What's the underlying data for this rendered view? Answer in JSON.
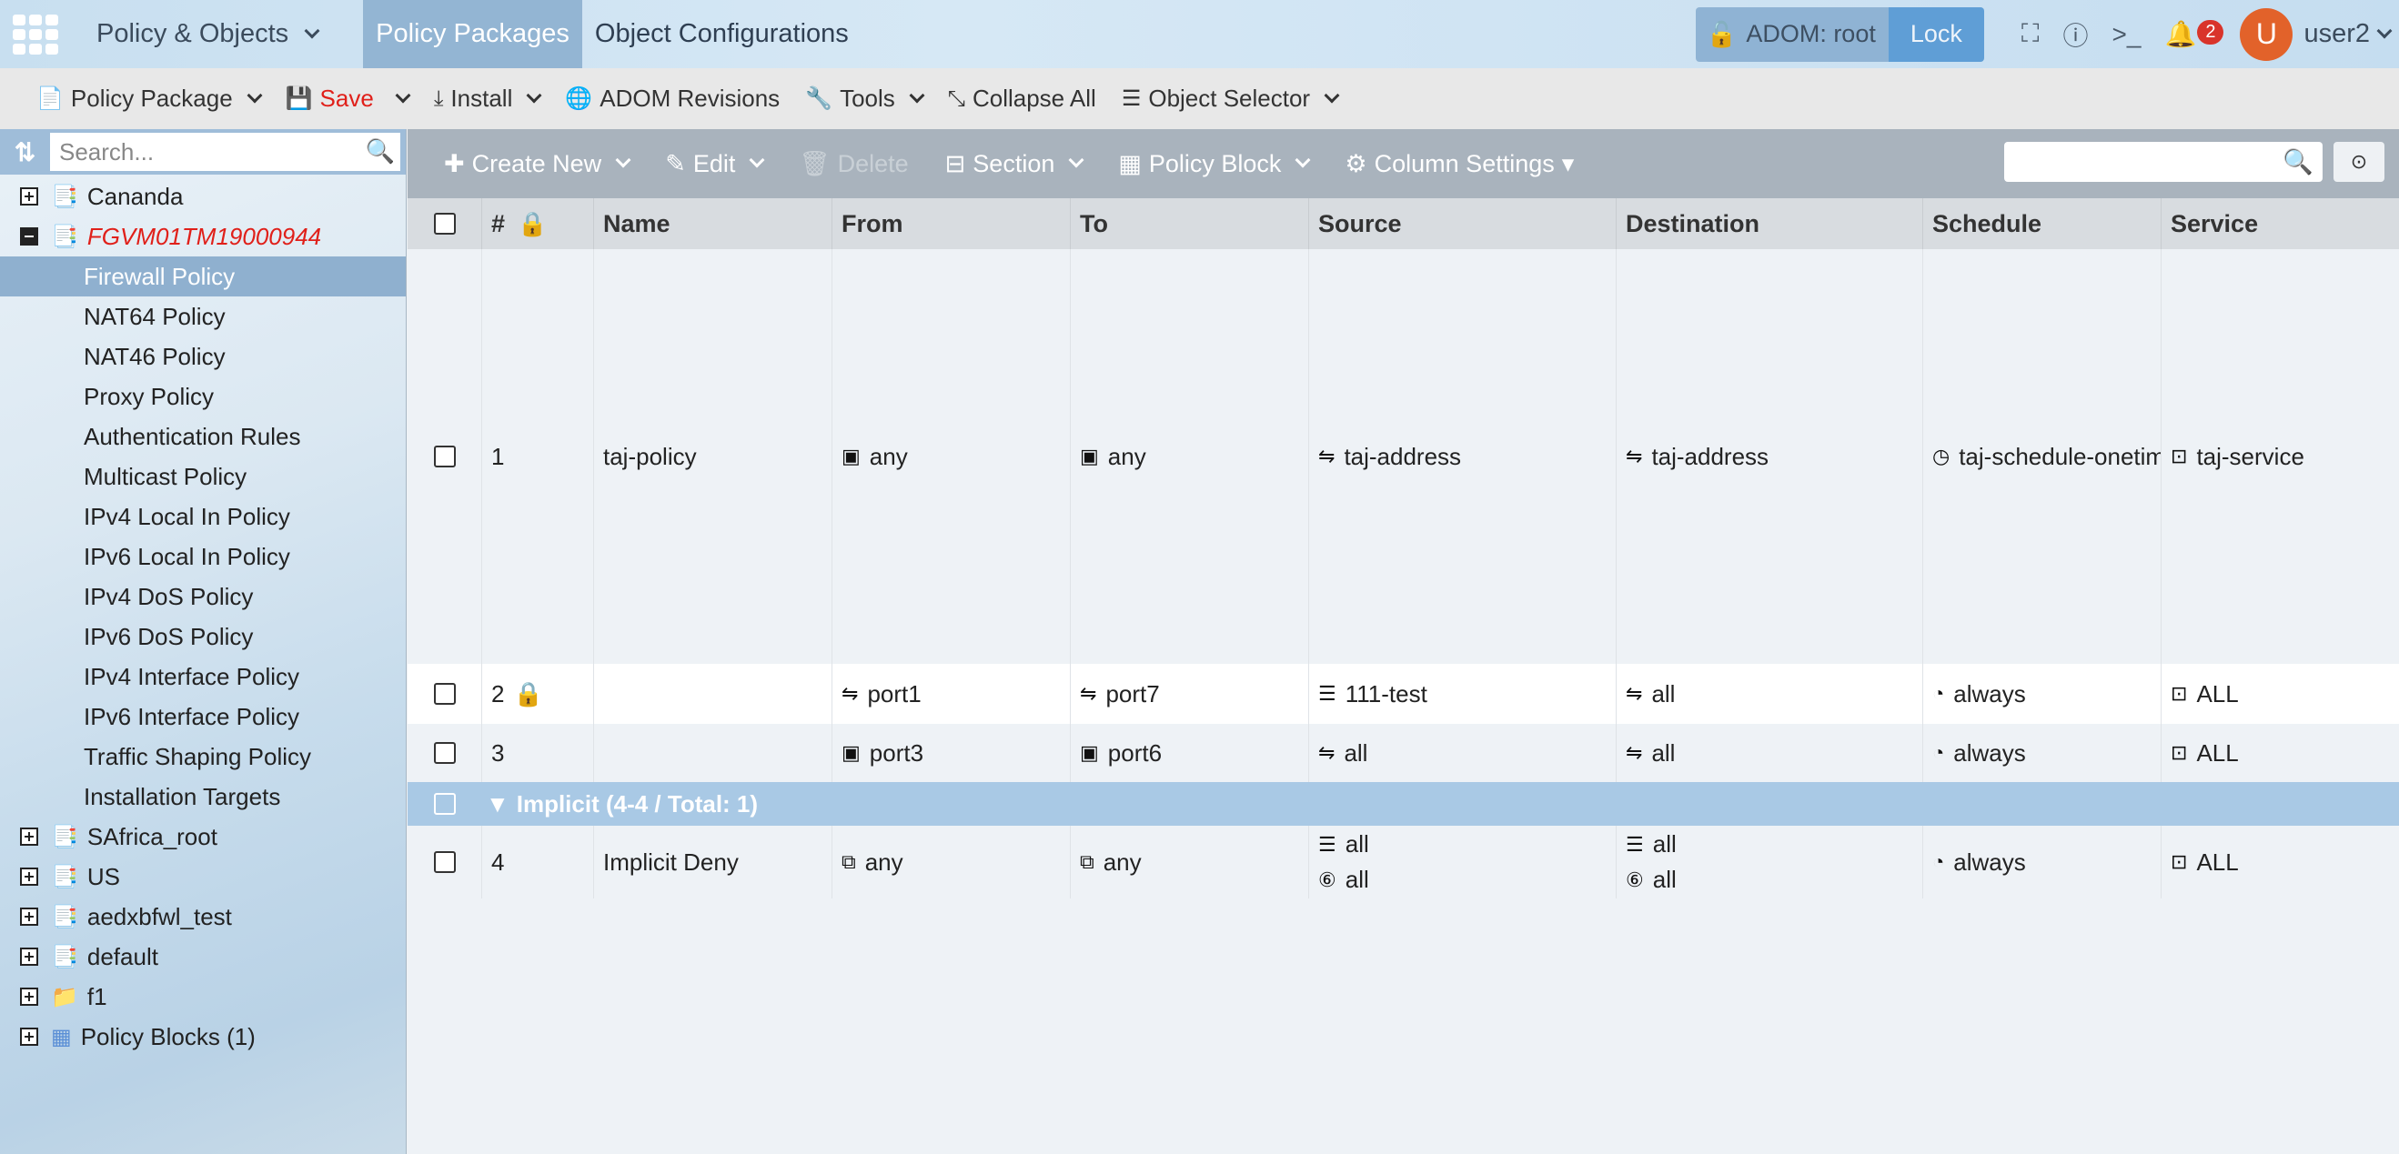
{
  "topbar": {
    "menu_label": "Policy & Objects",
    "tabs": [
      {
        "label": "Policy Packages",
        "active": true
      },
      {
        "label": "Object Configurations",
        "active": false
      }
    ],
    "adom_label": "ADOM: root",
    "lock_label": "Lock",
    "notification_count": "2",
    "avatar_letter": "U",
    "username": "user2"
  },
  "toolbar": {
    "policy_package": "Policy Package",
    "save": "Save",
    "install": "Install",
    "adom_revisions": "ADOM Revisions",
    "tools": "Tools",
    "collapse_all": "Collapse All",
    "object_selector": "Object Selector"
  },
  "sidebar": {
    "search_placeholder": "Search...",
    "tree": [
      {
        "label": "Cananda",
        "expand": "plus"
      },
      {
        "label": "FGVM01TM19000944",
        "expand": "minus"
      },
      {
        "label": "Firewall Policy",
        "selected": true
      },
      {
        "label": "NAT64 Policy"
      },
      {
        "label": "NAT46 Policy"
      },
      {
        "label": "Proxy Policy"
      },
      {
        "label": "Authentication Rules"
      },
      {
        "label": "Multicast Policy"
      },
      {
        "label": "IPv4 Local In Policy"
      },
      {
        "label": "IPv6 Local In Policy"
      },
      {
        "label": "IPv4 DoS Policy"
      },
      {
        "label": "IPv6 DoS Policy"
      },
      {
        "label": "IPv4 Interface Policy"
      },
      {
        "label": "IPv6 Interface Policy"
      },
      {
        "label": "Traffic Shaping Policy"
      },
      {
        "label": "Installation Targets"
      },
      {
        "label": "SAfrica_root",
        "expand": "plus"
      },
      {
        "label": "US",
        "expand": "plus"
      },
      {
        "label": "aedxbfwl_test",
        "expand": "plus"
      },
      {
        "label": "default",
        "expand": "plus"
      },
      {
        "label": "f1",
        "expand": "plus"
      },
      {
        "label": "Policy Blocks (1)",
        "expand": "plus"
      }
    ]
  },
  "policy_toolbar": {
    "create_new": "Create New",
    "edit": "Edit",
    "delete": "Delete",
    "section": "Section",
    "policy_block": "Policy Block",
    "column_settings": "Column Settings"
  },
  "table": {
    "headers": {
      "num": "#",
      "name": "Name",
      "from": "From",
      "to": "To",
      "source": "Source",
      "destination": "Destination",
      "schedule": "Schedule",
      "service": "Service"
    },
    "rows": [
      {
        "num": "1",
        "name": "taj-policy",
        "from": "any",
        "to": "any",
        "source": "taj-address",
        "destination": "taj-address",
        "schedule": "taj-schedule-onetime",
        "service": "taj-service"
      },
      {
        "num": "2",
        "name": "",
        "from": "port1",
        "to": "port7",
        "source": "111-test",
        "destination": "all",
        "schedule": "always",
        "service": "ALL"
      },
      {
        "num": "3",
        "name": "",
        "from": "port3",
        "to": "port6",
        "source": "all",
        "destination": "all",
        "schedule": "always",
        "service": "ALL"
      }
    ],
    "section_label": "Implicit (4-4 / Total: 1)",
    "implicit_row": {
      "num": "4",
      "name": "Implicit Deny",
      "from": "any",
      "to": "any",
      "source_1": "all",
      "source_2": "all",
      "destination_1": "all",
      "destination_2": "all",
      "schedule": "always",
      "service": "ALL"
    }
  },
  "colors": {
    "active_tab": "#93b5d3",
    "save": "#e0201a",
    "selected_tree_item": "#8fb0cf",
    "section_row": "#a9c9e5",
    "avatar": "#e2622a",
    "badge": "#d9342b"
  }
}
